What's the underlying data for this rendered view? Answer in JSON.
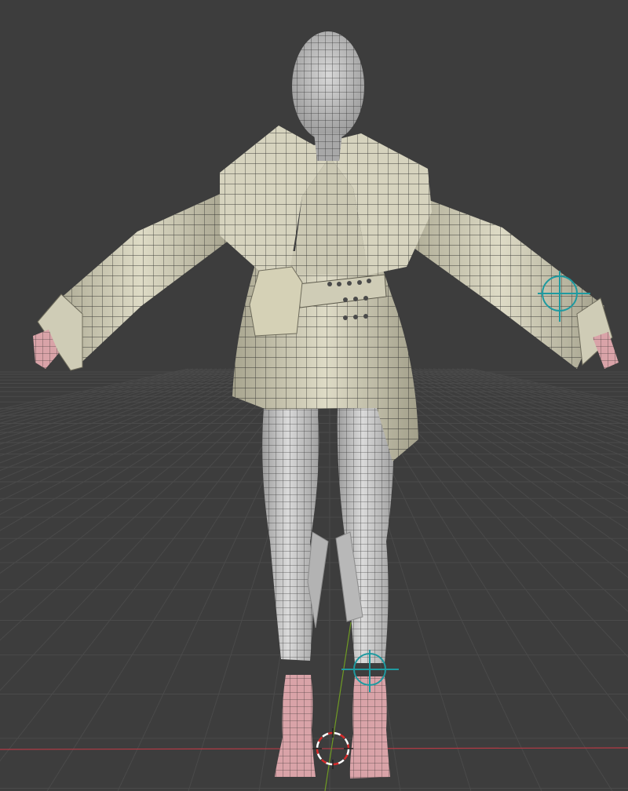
{
  "viewport": {
    "background_color": "#3d3d3d",
    "grid_color": "#4a4a4a",
    "x_axis_color": "#b33a45",
    "y_axis_color": "#6f9a24"
  },
  "model": {
    "cloth_color": "#d8d5c0",
    "skin_wire_color": "#cfcfcf",
    "skin_pink_color": "#d9a3a8",
    "wire_color": "#1c1c1c"
  },
  "gizmos": {
    "empty_color": "#1f9aa0",
    "cursor_colors": [
      "#d62b2b",
      "#ffffff"
    ],
    "items": [
      {
        "name": "hand-ik-target-right",
        "icon": "crosshair-empty-icon"
      },
      {
        "name": "foot-ik-target-left",
        "icon": "crosshair-empty-icon"
      },
      {
        "name": "3d-cursor",
        "icon": "3d-cursor-icon"
      }
    ]
  }
}
